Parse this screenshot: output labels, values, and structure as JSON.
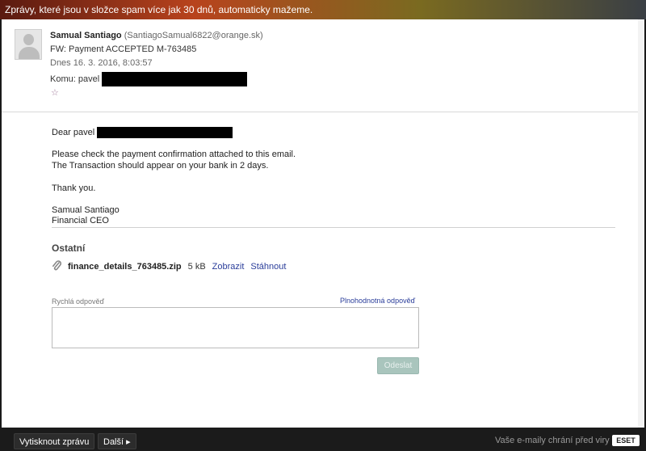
{
  "banner": {
    "text": "Zprávy, které jsou v složce spam více jak 30 dnů, automaticky mažeme."
  },
  "header": {
    "sender_name": "Samual Santiago",
    "sender_email": "(SantiagoSamual6822@orange.sk)",
    "subject": "FW: Payment ACCEPTED M-763485",
    "date_label": "Dnes",
    "date_value": "16. 3. 2016, 8:03:57",
    "to_label": "Komu: pavel",
    "star": "☆"
  },
  "body": {
    "greeting": "Dear pavel",
    "line1": "Please check the payment confirmation attached to this email.",
    "line2": "The Transaction should appear on your bank in 2 days.",
    "thanks": "Thank you.",
    "sig_name": "Samual Santiago",
    "sig_title": "Financial CEO"
  },
  "attachments": {
    "section_title": "Ostatní",
    "file_name": "finance_details_763485.zip",
    "file_size": "5 kB",
    "view_label": "Zobrazit",
    "download_label": "Stáhnout"
  },
  "reply": {
    "label": "Rychlá odpověď",
    "full_reply_link": "Plnohodnotná odpověď",
    "send_label": "Odeslat"
  },
  "footer": {
    "print_label": "Vytisknout zprávu",
    "next_label": "Další ▸",
    "protect_text": "Vaše e-maily chrání před viry",
    "eset_logo": "ESET"
  },
  "colors": {
    "link": "#2a3d9a",
    "footer_bg": "#1b1b1b",
    "send_button": "#a9c5bd"
  }
}
